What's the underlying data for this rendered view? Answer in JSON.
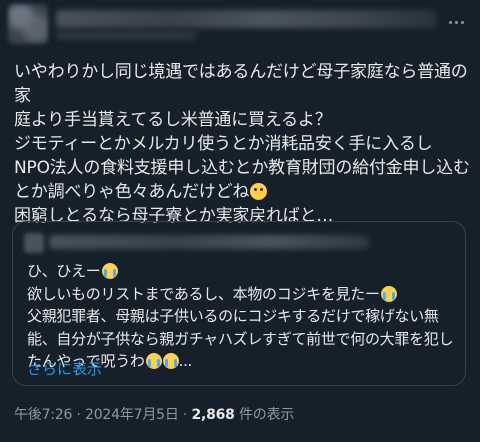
{
  "tweet": {
    "text_lines": [
      "いやわりかし同じ境遇ではあるんだけど母子家庭なら普通の家",
      "庭より手当貰えてるし米普通に買えるよ？",
      "ジモティーとかメルカリ使うとか消耗品安く手に入るし",
      "NPO法人の食料支援申し込むとか教育財団の給付金申し込む",
      "とか調べりゃ色々あんだけどね",
      "困窮しとるなら母子寮とか実家戻ればと…"
    ],
    "line5_emoji": "rolling-eyes-emoji"
  },
  "quote": {
    "lines": [
      "ひ、ひえー",
      "欲しいものリストまであるし、本物のコジキを見たー",
      "父親犯罪者、母親は子供いるのにコジキするだけで稼げない無",
      "能、自分が子供なら親ガチャハズレすぎて前世で何の大罪を犯し",
      "たんやっで呪うわ",
      "..."
    ],
    "show_more": "さらに表示",
    "emoji": "loudly-crying-emoji"
  },
  "meta": {
    "time": "午後7:26",
    "separator": " · ",
    "date": "2024年7月5日",
    "views_count": "2,868",
    "views_label": " 件の表示"
  },
  "colors": {
    "background": "#15202b",
    "text": "#e7e9ea",
    "secondary": "#8b98a5",
    "link": "#1d9bf0",
    "border": "#38444d"
  }
}
